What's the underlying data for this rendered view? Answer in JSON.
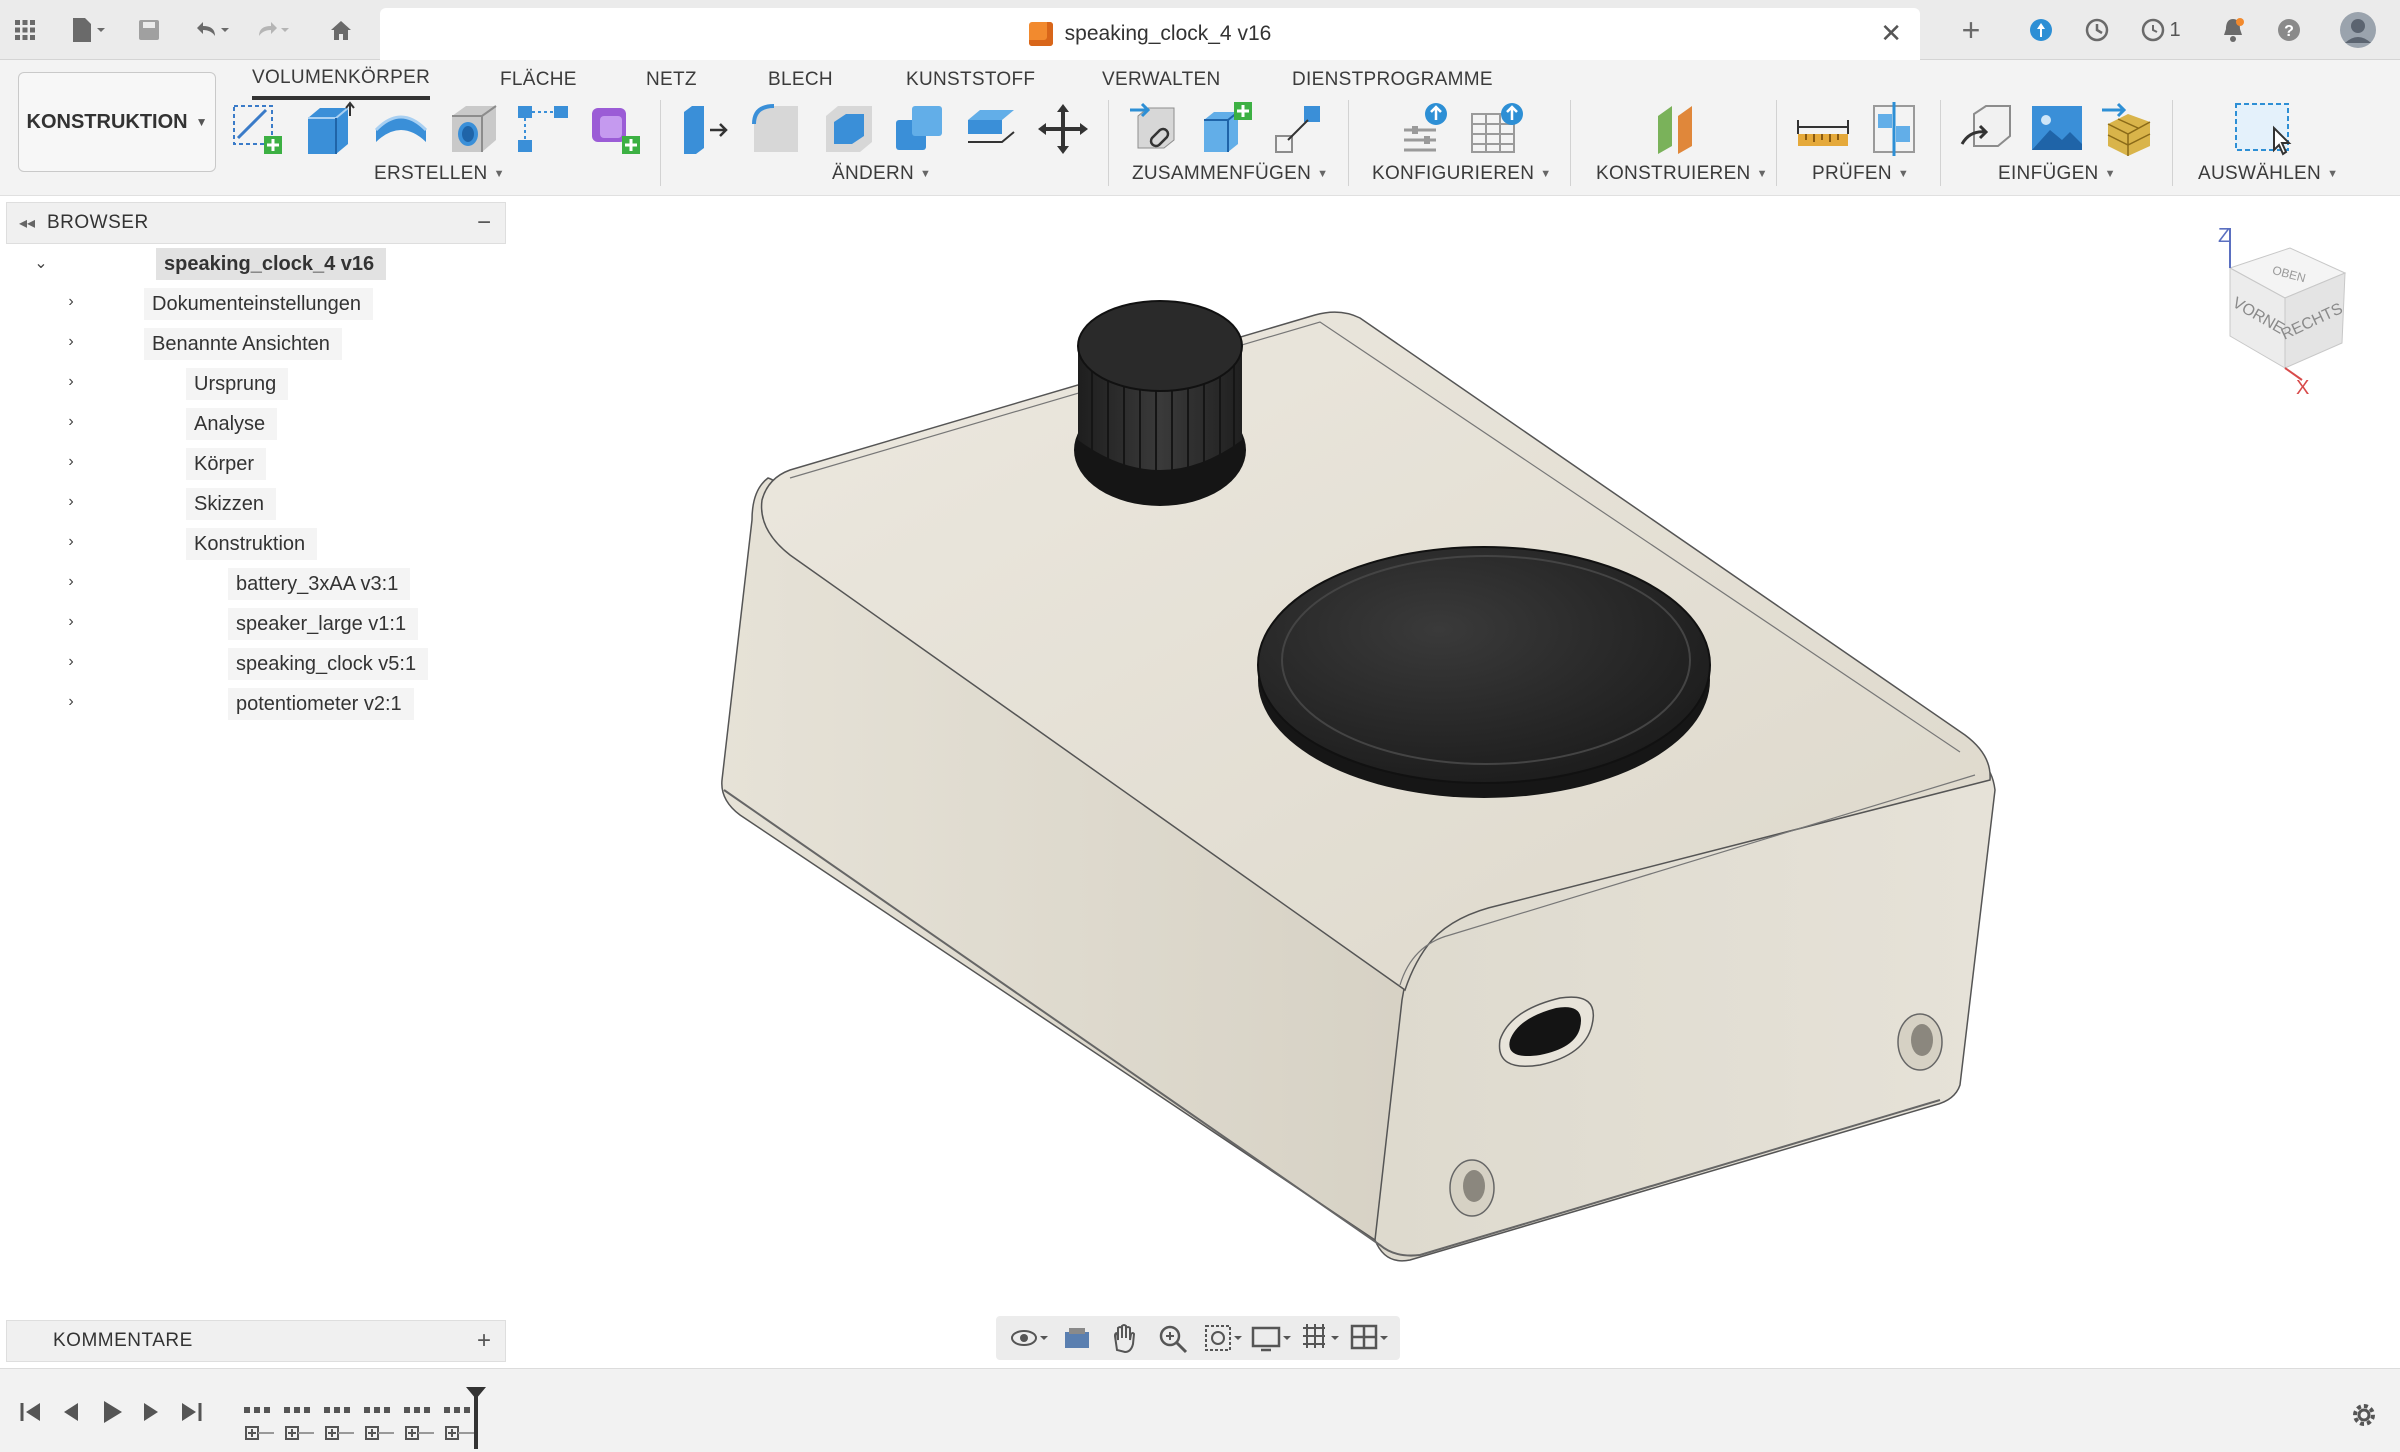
{
  "window": {
    "document_title": "speaking_clock_4 v16",
    "notification_count": "1",
    "top_icons": [
      "apps-grid-icon",
      "file-icon",
      "save-icon",
      "undo-icon",
      "redo-icon",
      "home-icon",
      "new-tab-icon",
      "sync-icon",
      "jobs-icon",
      "history-icon",
      "notifications-icon",
      "help-icon",
      "avatar"
    ]
  },
  "ribbon": {
    "workspace": "KONSTRUKTION",
    "tabs": [
      "VOLUMENKÖRPER",
      "FLÄCHE",
      "NETZ",
      "BLECH",
      "KUNSTSTOFF",
      "VERWALTEN",
      "DIENSTPROGRAMME"
    ],
    "active_tab": "VOLUMENKÖRPER",
    "groups": {
      "erstellen": "ERSTELLEN",
      "aendern": "ÄNDERN",
      "zusammenfuegen": "ZUSAMMENFÜGEN",
      "konfigurieren": "KONFIGURIEREN",
      "konstruieren": "KONSTRUIEREN",
      "pruefen": "PRÜFEN",
      "einfuegen": "EINFÜGEN",
      "auswaehlen": "AUSWÄHLEN"
    }
  },
  "browser": {
    "title": "BROWSER",
    "root": "speaking_clock_4 v16",
    "items": [
      {
        "label": "Dokumenteinstellungen",
        "icon": "gear-icon",
        "visibility": "none"
      },
      {
        "label": "Benannte Ansichten",
        "icon": "folder-icon",
        "visibility": "none"
      },
      {
        "label": "Ursprung",
        "icon": "folder-icon",
        "visibility": "hidden"
      },
      {
        "label": "Analyse",
        "icon": "folder-icon",
        "visibility": "hidden"
      },
      {
        "label": "Körper",
        "icon": "folder-icon",
        "visibility": "visible"
      },
      {
        "label": "Skizzen",
        "icon": "folder-icon",
        "visibility": "visible"
      },
      {
        "label": "Konstruktion",
        "icon": "folder-icon",
        "visibility": "visible"
      },
      {
        "label": "battery_3xAA v3:1",
        "icon": "component-icon",
        "visibility": "visible"
      },
      {
        "label": "speaker_large v1:1",
        "icon": "body-icon",
        "visibility": "visible"
      },
      {
        "label": "speaking_clock v5:1",
        "icon": "assembly-icon",
        "visibility": "visible"
      },
      {
        "label": "potentiometer v2:1",
        "icon": "body-icon",
        "visibility": "visible"
      }
    ]
  },
  "comments": {
    "title": "KOMMENTARE"
  },
  "viewcube": {
    "top": "OBEN",
    "front": "VORNE",
    "right": "RECHTS",
    "axis_z": "Z",
    "axis_x": "X"
  },
  "colors": {
    "enclosure": "#e4e0d6",
    "knob": "#2a2a2a",
    "accent_blue": "#2d8fd5",
    "doc_orange": "#f28a2e"
  }
}
